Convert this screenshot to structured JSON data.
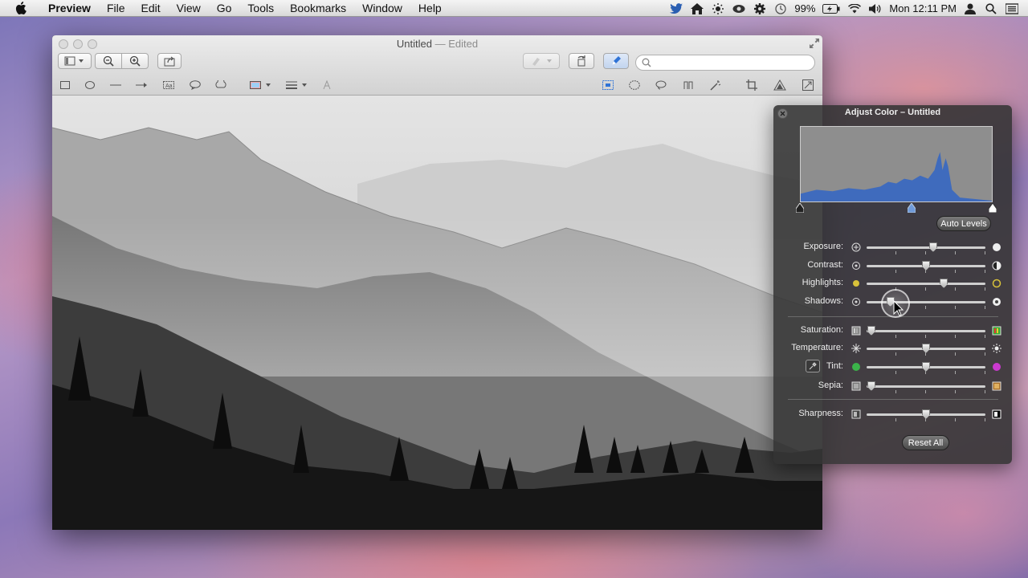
{
  "menubar": {
    "app_name": "Preview",
    "items": [
      "File",
      "Edit",
      "View",
      "Go",
      "Tools",
      "Bookmarks",
      "Window",
      "Help"
    ],
    "battery": "99%",
    "clock": "Mon 12:11 PM"
  },
  "window": {
    "title": "Untitled",
    "title_separator": "—",
    "edited": "Edited",
    "search_placeholder": ""
  },
  "adjust_panel": {
    "title": "Adjust Color – Untitled",
    "auto_levels": "Auto Levels",
    "reset_all": "Reset All",
    "sliders": [
      {
        "label": "Exposure:",
        "value": 0.56
      },
      {
        "label": "Contrast:",
        "value": 0.5
      },
      {
        "label": "Highlights:",
        "value": 0.65
      },
      {
        "label": "Shadows:",
        "value": 0.2
      },
      {
        "label": "Saturation:",
        "value": 0.04
      },
      {
        "label": "Temperature:",
        "value": 0.5
      },
      {
        "label": "Tint:",
        "value": 0.5
      },
      {
        "label": "Sepia:",
        "value": 0.04
      },
      {
        "label": "Sharpness:",
        "value": 0.5
      }
    ],
    "levels": {
      "black": 0.0,
      "mid": 0.58,
      "white": 1.0
    }
  },
  "colors": {
    "histogram_fill": "#3f6bbd",
    "panel_bg": "#323232"
  }
}
